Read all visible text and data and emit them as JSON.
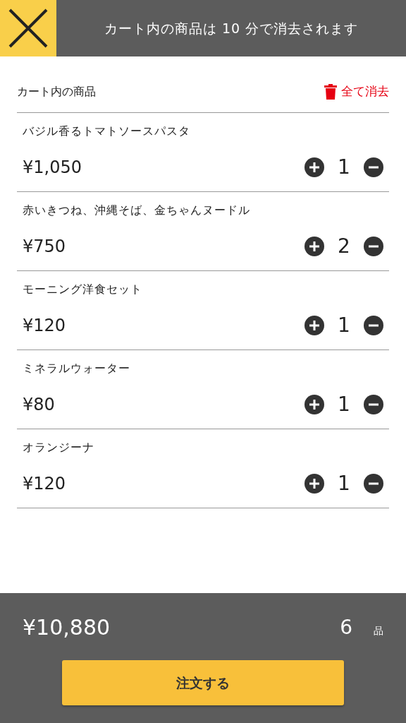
{
  "header": {
    "title": "カート内の商品は 10 分で消去されます"
  },
  "cart": {
    "heading": "カート内の商品",
    "clear_all": "全て消去"
  },
  "items": [
    {
      "name": "バジル香るトマトソースパスタ",
      "price": "¥1,050",
      "quantity": "1"
    },
    {
      "name": "赤いきつね、沖縄そば、金ちゃんヌードル",
      "price": "¥750",
      "quantity": "2"
    },
    {
      "name": "モーニング洋食セット",
      "price": "¥120",
      "quantity": "1"
    },
    {
      "name": "ミネラルウォーター",
      "price": "¥80",
      "quantity": "1"
    },
    {
      "name": "オランジーナ",
      "price": "¥120",
      "quantity": "1"
    }
  ],
  "footer": {
    "total": "¥10,880",
    "count": "6",
    "count_unit": "品",
    "order_button": "注文する"
  }
}
